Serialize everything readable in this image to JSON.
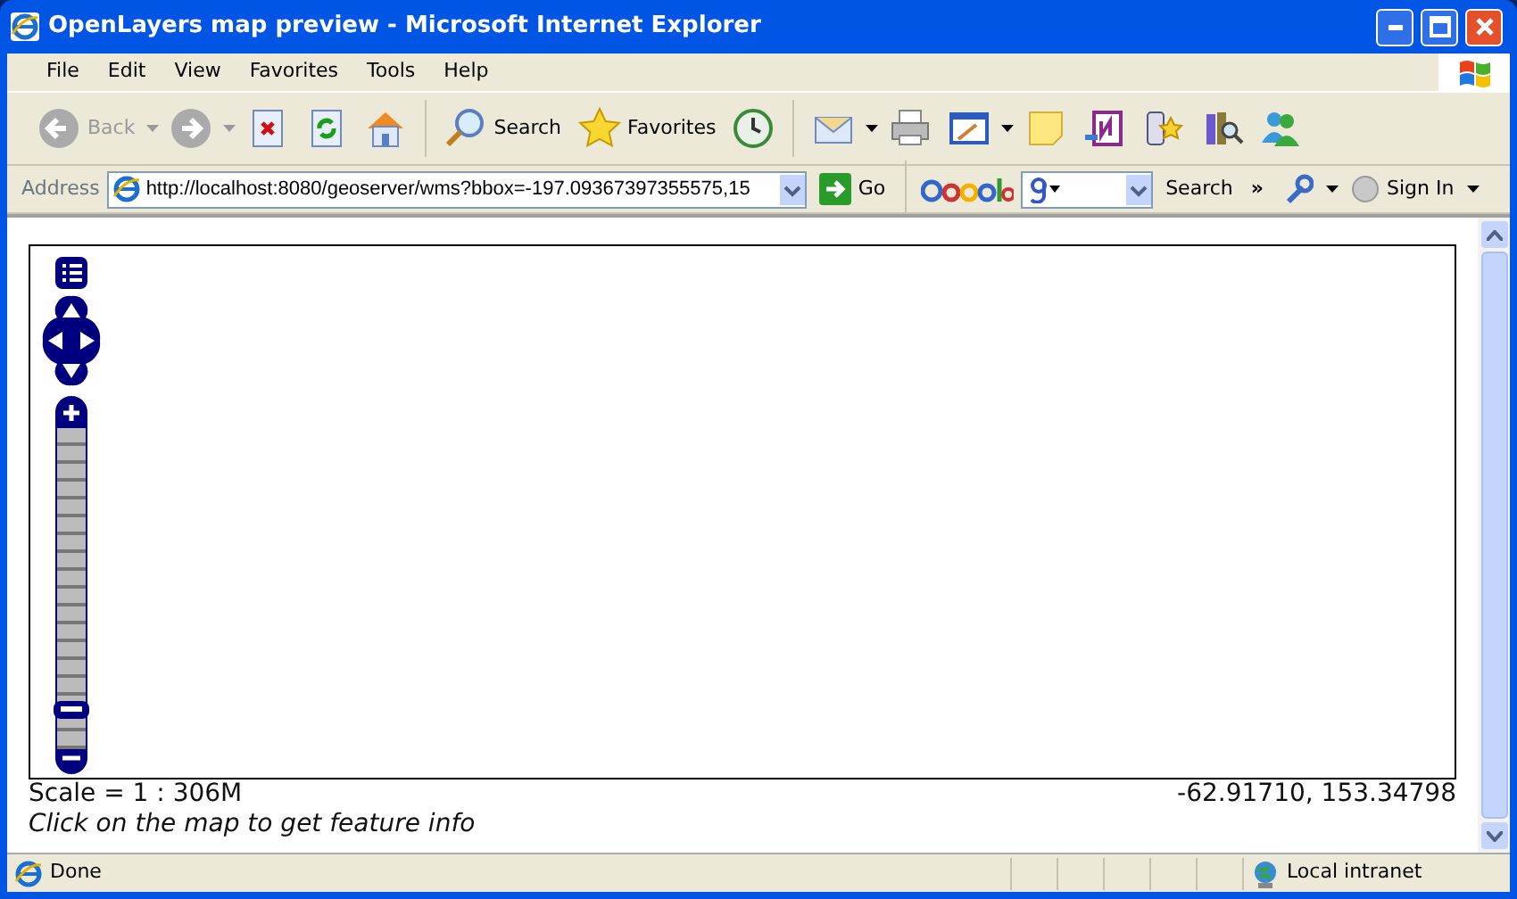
{
  "window": {
    "title": "OpenLayers map preview - Microsoft Internet Explorer"
  },
  "menu": [
    "File",
    "Edit",
    "View",
    "Favorites",
    "Tools",
    "Help"
  ],
  "toolbar": {
    "back": {
      "label": "Back",
      "disabled": true
    },
    "forward": {
      "disabled": true
    },
    "search": "Search",
    "favorites": "Favorites"
  },
  "address_bar": {
    "label": "Address",
    "url": "http://localhost:8080/geoserver/wms?bbox=-197.09367397355575,15",
    "go": "Go"
  },
  "google_bar": {
    "search": "Search",
    "chevron": "»",
    "sign_in": "Sign In"
  },
  "map": {
    "zoom": {
      "level": 0.1
    },
    "scale": "Scale = 1 : 306M",
    "coordinates": "-62.91710, 153.34798",
    "info": "Click on the map to get feature info"
  },
  "status_bar": {
    "text": "Done",
    "zone": "Local intranet"
  }
}
